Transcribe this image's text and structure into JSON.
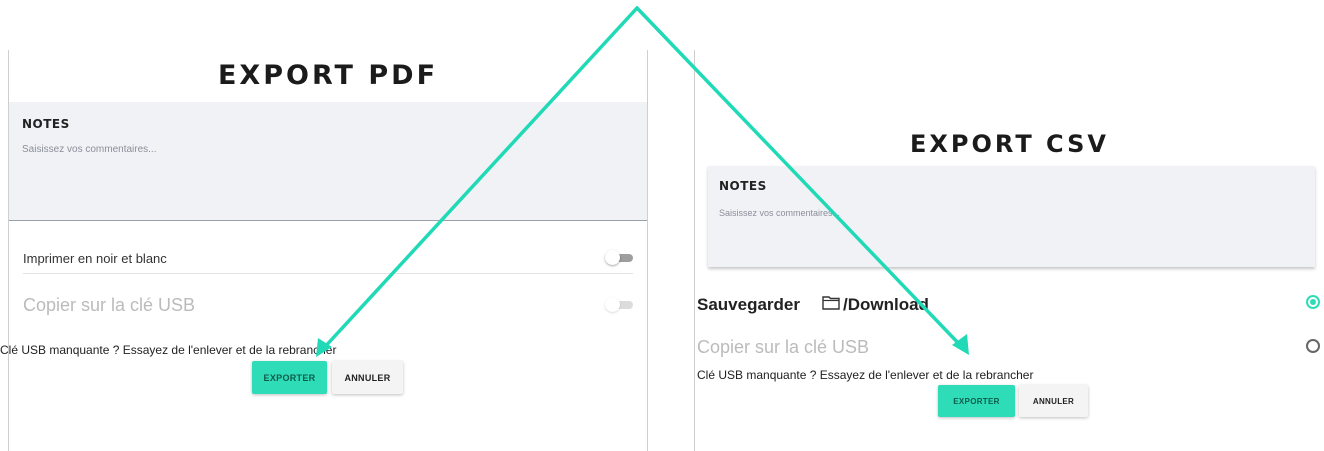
{
  "pdf_panel": {
    "title": "EXPORT PDF",
    "notes_label": "NOTES",
    "notes_placeholder": "Saisissez vos commentaires...",
    "print_bw_label": "Imprimer en noir et blanc",
    "usb_copy_label": "Copier sur la clé USB",
    "usb_hint": "Clé USB manquante ? Essayez de l'enlever et de la rebrancher",
    "export_label": "EXPORTER",
    "cancel_label": "ANNULER"
  },
  "csv_panel": {
    "title": "EXPORT CSV",
    "notes_label": "NOTES",
    "notes_placeholder": "Saisissez vos commentaires...",
    "save_label": "Sauvegarder",
    "save_path": "/Download",
    "usb_copy_label": "Copier sur la clé USB",
    "usb_hint": "Clé USB manquante ? Essayez de l'enlever et de la rebrancher",
    "export_label": "EXPORTER",
    "cancel_label": "ANNULER"
  },
  "colors": {
    "accent": "#2fdcb8",
    "arrow": "#20d9b6",
    "notes_background": "#f1f2f6"
  }
}
